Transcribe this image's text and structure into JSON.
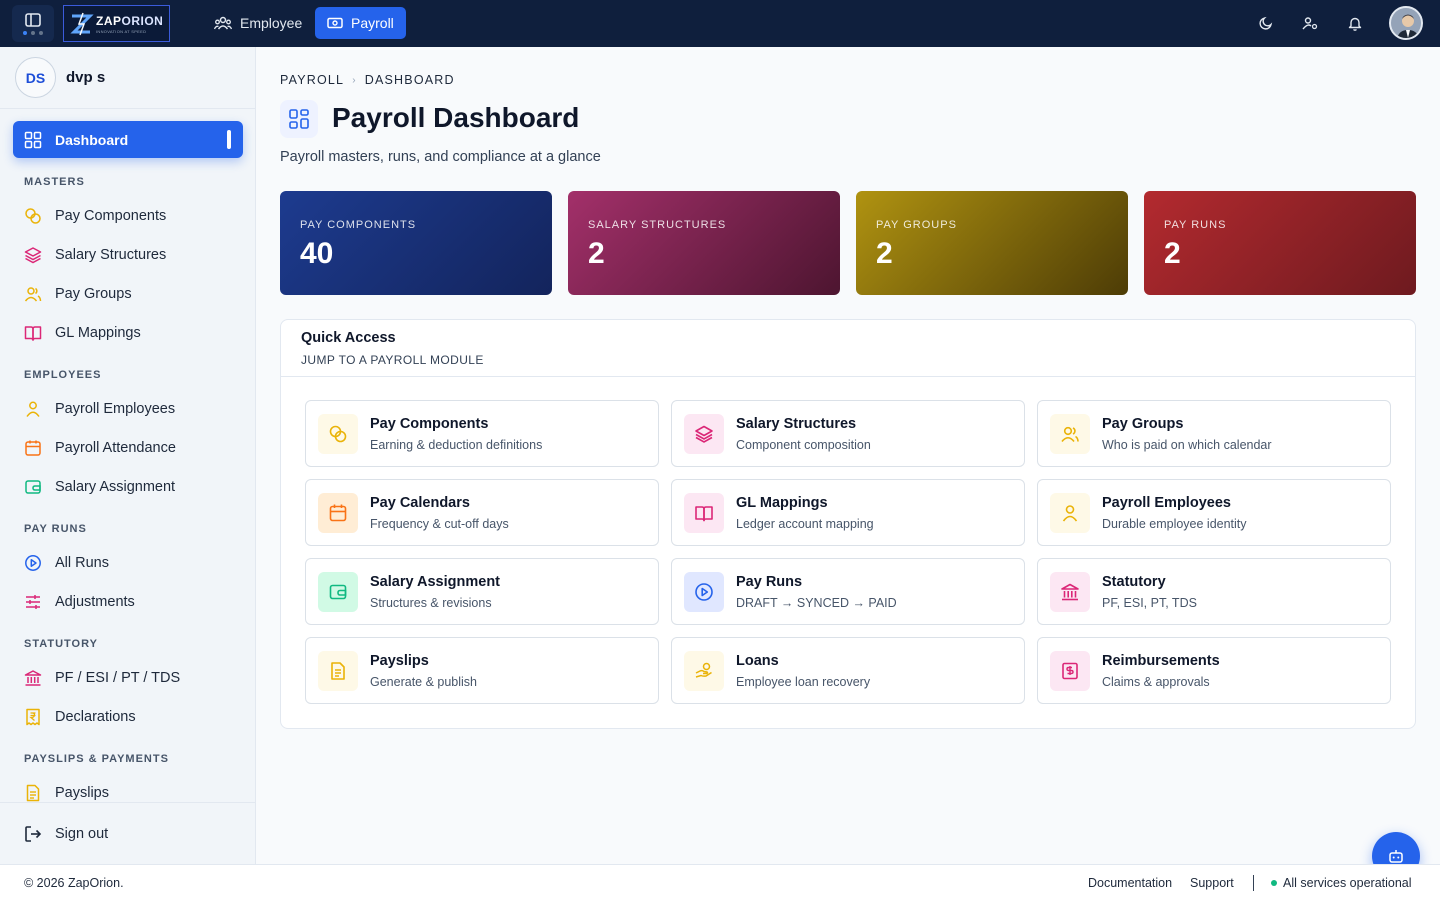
{
  "topbar": {
    "logo": {
      "name_part1": "ZAP",
      "name_part2": "ORION",
      "tagline": "INNOVATION AT SPEED"
    },
    "tabs": [
      {
        "label": "Employee",
        "icon": "users-icon",
        "active": false
      },
      {
        "label": "Payroll",
        "icon": "money-icon",
        "active": true
      }
    ],
    "icons": [
      "moon-icon",
      "user-cog-icon",
      "bell-icon",
      "avatar"
    ]
  },
  "sidebar": {
    "user": {
      "initials": "DS",
      "name": "dvp s"
    },
    "active_item": {
      "label": "Dashboard",
      "icon": "dashboard-icon"
    },
    "sections": {
      "masters": "MASTERS",
      "employees": "EMPLOYEES",
      "pay_runs": "PAY RUNS",
      "statutory": "STATUTORY",
      "payslips_payments": "PAYSLIPS & PAYMENTS"
    },
    "items": {
      "pay_components": "Pay Components",
      "salary_structures": "Salary Structures",
      "pay_groups": "Pay Groups",
      "gl_mappings": "GL Mappings",
      "payroll_employees": "Payroll Employees",
      "payroll_attendance": "Payroll Attendance",
      "salary_assignment": "Salary Assignment",
      "all_runs": "All Runs",
      "adjustments": "Adjustments",
      "pf_esi": "PF / ESI / PT / TDS",
      "declarations": "Declarations",
      "payslips": "Payslips"
    },
    "signout": "Sign out"
  },
  "main": {
    "breadcrumb": [
      "PAYROLL",
      "DASHBOARD"
    ],
    "title": "Payroll Dashboard",
    "subtitle": "Payroll masters, runs, and compliance at a glance",
    "stats": [
      {
        "label": "PAY COMPONENTS",
        "value": "40",
        "color": "#1e3a8a"
      },
      {
        "label": "SALARY STRUCTURES",
        "value": "2",
        "color": "#9d2a5f"
      },
      {
        "label": "PAY GROUPS",
        "value": "2",
        "color": "#a88a0e"
      },
      {
        "label": "PAY RUNS",
        "value": "2",
        "color": "#a3262b"
      }
    ],
    "quick_access": {
      "title": "Quick Access",
      "subtitle": "JUMP TO A PAYROLL MODULE",
      "cards": [
        {
          "name": "Pay Components",
          "desc": "Earning & deduction definitions"
        },
        {
          "name": "Salary Structures",
          "desc": "Component composition"
        },
        {
          "name": "Pay Groups",
          "desc": "Who is paid on which calendar"
        },
        {
          "name": "Pay Calendars",
          "desc": "Frequency & cut-off days"
        },
        {
          "name": "GL Mappings",
          "desc": "Ledger account mapping"
        },
        {
          "name": "Payroll Employees",
          "desc": "Durable employee identity"
        },
        {
          "name": "Salary Assignment",
          "desc": "Structures & revisions"
        },
        {
          "name": "Pay Runs",
          "desc": "DRAFT → SYNCED → PAID"
        },
        {
          "name": "Statutory",
          "desc": "PF, ESI, PT, TDS"
        },
        {
          "name": "Payslips",
          "desc": "Generate & publish"
        },
        {
          "name": "Loans",
          "desc": "Employee loan recovery"
        },
        {
          "name": "Reimbursements",
          "desc": "Claims & approvals"
        }
      ]
    }
  },
  "footer": {
    "copyright": "© 2026 ZapOrion.",
    "documentation": "Documentation",
    "support": "Support",
    "status": "All services operational"
  },
  "colors": {
    "accent": "#2563eb",
    "topbar": "#0f1f3d",
    "status_ok": "#10b981"
  }
}
